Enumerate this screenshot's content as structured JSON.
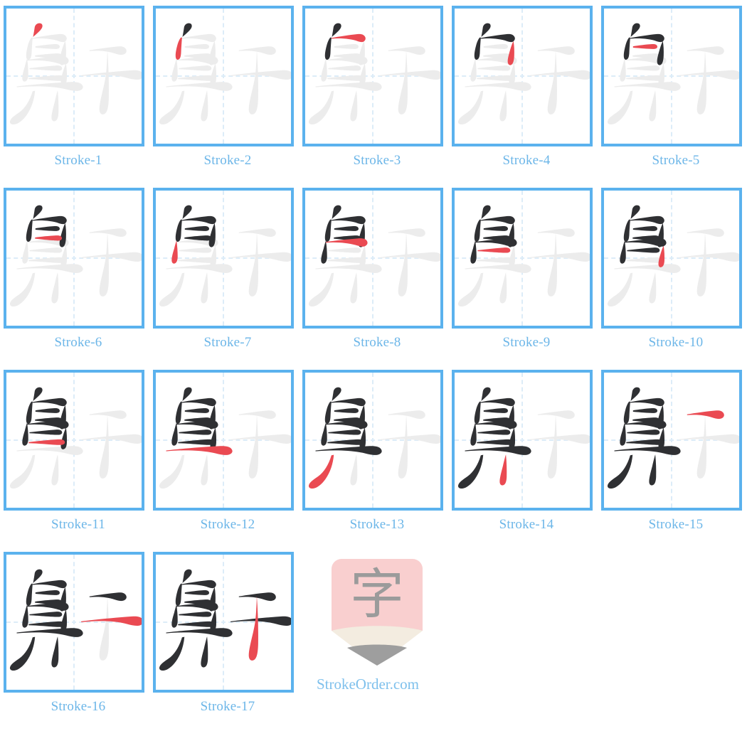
{
  "page": {
    "character": "鼾",
    "total_strokes": 17,
    "columns": 5,
    "colors": {
      "box_border": "#5bb2ee",
      "guide_line": "#dcecf8",
      "ghost_stroke": "#ececec",
      "done_stroke": "#2f3033",
      "active_stroke": "#ea4a52",
      "label_text": "#6cb6e8",
      "brand_text": "#7ec0ec",
      "logo_body": "#f9cfcf",
      "logo_wedge": "#f3ece0",
      "logo_tip": "#9e9e9e",
      "logo_char": "#9b9b9b"
    }
  },
  "cells": [
    {
      "label": "Stroke-1",
      "index": 1
    },
    {
      "label": "Stroke-2",
      "index": 2
    },
    {
      "label": "Stroke-3",
      "index": 3
    },
    {
      "label": "Stroke-4",
      "index": 4
    },
    {
      "label": "Stroke-5",
      "index": 5
    },
    {
      "label": "Stroke-6",
      "index": 6
    },
    {
      "label": "Stroke-7",
      "index": 7
    },
    {
      "label": "Stroke-8",
      "index": 8
    },
    {
      "label": "Stroke-9",
      "index": 9
    },
    {
      "label": "Stroke-10",
      "index": 10
    },
    {
      "label": "Stroke-11",
      "index": 11
    },
    {
      "label": "Stroke-12",
      "index": 12
    },
    {
      "label": "Stroke-13",
      "index": 13
    },
    {
      "label": "Stroke-14",
      "index": 14
    },
    {
      "label": "Stroke-15",
      "index": 15
    },
    {
      "label": "Stroke-16",
      "index": 16
    },
    {
      "label": "Stroke-17",
      "index": 17
    }
  ],
  "footer": {
    "logo_character": "字",
    "logo_name": "strokeorder-logo",
    "brand": "StrokeOrder.com"
  },
  "strokes": [
    "M 374 103 C 382 96 399 82 409 71 C 416 63 420 57 421 51 C 423 40 416 33 404 34 C 393 35 384 44 382 56 C 380 70 377 88 374 103 Z",
    "M 372 106 C 370 130 368 158 367 184 C 366 198 364 207 360 212 C 352 222 342 218 340 205 C 338 190 342 168 348 146 C 353 127 360 113 366 106 Z",
    "M 372 108 C 412 101 463 93 502 89 C 520 87 531 90 538 98 C 546 107 545 117 537 124 C 529 131 517 129 503 124 C 470 112 416 108 372 112 Z",
    "M 536 124 C 540 146 541 172 540 197 C 539 217 536 231 531 238 C 523 249 512 247 508 234 C 505 222 510 200 518 173 C 524 152 530 134 536 124 Z",
    "M 386 150 C 412 146 450 141 482 139 C 496 138 504 141 507 147 C 511 155 506 162 495 163 C 478 165 432 161 386 157 Z",
    "M 384 196 C 412 192 455 188 490 186 C 506 185 515 188 518 195 C 522 204 516 211 503 212 C 484 213 432 207 384 202 Z",
    "M 344 212 C 348 238 350 266 350 292 C 350 309 346 320 339 325 C 330 331 321 326 320 313 C 319 299 325 276 333 251 C 337 234 341 220 344 212 Z",
    "M 344 218 C 390 212 452 205 504 201 C 528 199 542 202 549 211 C 557 222 554 233 542 239 C 530 245 512 240 492 234 C 454 223 396 218 344 222 Z",
    "M 356 260 C 390 256 444 250 488 247 C 506 246 516 249 519 256 C 523 265 517 272 504 273 C 484 275 422 268 356 265 Z",
    "M 540 238 C 544 264 545 290 544 314 C 543 330 539 340 532 344 C 523 349 515 344 514 332 C 513 318 519 296 527 271 C 532 254 537 243 540 238 Z",
    "M 352 310 C 390 305 450 299 500 296 C 519 295 530 298 533 306 C 537 316 530 323 516 324 C 494 326 424 317 352 315 Z",
    "M 292 352 C 350 345 460 335 556 330 C 590 328 610 332 619 342 C 630 354 626 366 610 372 C 594 378 568 373 540 366 C 472 350 376 348 292 356 Z",
    "M 384 374 C 380 420 366 462 342 496 C 322 524 300 540 282 543 C 264 546 254 537 259 524 C 264 511 281 499 304 483 C 334 462 358 424 372 376 Z",
    "M 498 372 C 502 412 503 450 502 486 C 501 508 496 520 488 525 C 478 531 468 525 467 511 C 466 495 473 467 483 430 C 489 404 494 384 498 372 Z",
    "M 658 170 C 700 163 756 155 800 151 C 820 149 832 152 839 161 C 848 172 845 184 832 190 C 819 196 802 192 784 186 C 750 174 704 170 658 174 Z",
    "M 616 296 C 676 288 784 277 872 271 C 898 269 915 273 924 283 C 935 296 931 309 914 315 C 897 321 872 316 846 309 C 784 292 696 291 616 300 Z",
    "M 748 168 C 754 250 756 330 755 408 C 754 452 749 477 738 487 C 724 499 710 492 708 472 C 706 450 716 408 730 350 C 739 310 745 282 748 168 Z"
  ]
}
